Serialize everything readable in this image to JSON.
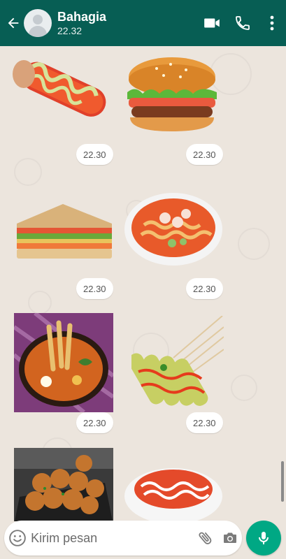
{
  "header": {
    "contact_name": "Bahagia",
    "last_seen": "22.32",
    "icons": [
      "back-arrow-icon",
      "video-call-icon",
      "voice-call-icon",
      "more-vertical-icon"
    ]
  },
  "messages": [
    {
      "sticker": "corn-dog-sticker",
      "time": "22.30"
    },
    {
      "sticker": "burger-sticker",
      "time": "22.30"
    },
    {
      "sticker": "sandwich-sticker",
      "time": "22.30"
    },
    {
      "sticker": "noodle-soup-sticker",
      "time": "22.30"
    },
    {
      "sticker": "chicken-feet-soup-sticker",
      "time": "22.30"
    },
    {
      "sticker": "skewers-sticker",
      "time": "22.30"
    },
    {
      "sticker": "fried-chicken-balls-sticker",
      "time": ""
    },
    {
      "sticker": "dessert-plate-sticker",
      "time": ""
    }
  ],
  "composer": {
    "placeholder": "Kirim pesan",
    "icons": [
      "emoji-icon",
      "attach-icon",
      "camera-icon",
      "mic-icon"
    ]
  },
  "colors": {
    "header_bg": "#075e54",
    "chat_bg": "#ece5dd",
    "accent": "#00a884"
  }
}
